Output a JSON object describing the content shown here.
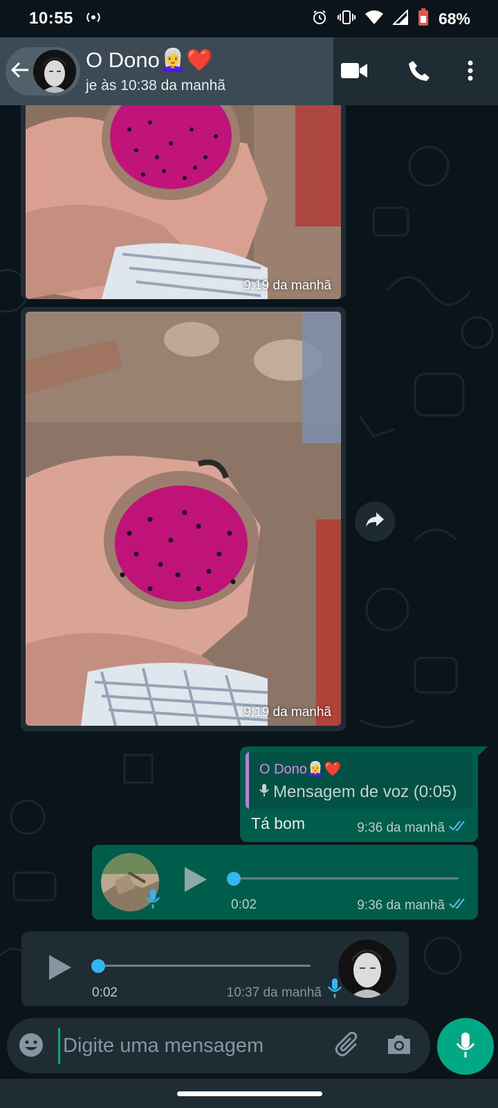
{
  "status_bar": {
    "time": "10:55",
    "battery": "68%",
    "icons": [
      "radio-icon",
      "alarm-icon",
      "vibrate-icon",
      "wifi-icon",
      "signal-icon",
      "battery-icon"
    ]
  },
  "header": {
    "contact_name": "O Dono👩‍🦳❤️",
    "last_seen": "je às 10:38 da manhã",
    "icons": [
      "back-arrow-icon",
      "video-call-icon",
      "voice-call-icon",
      "more-menu-icon"
    ]
  },
  "messages": [
    {
      "type": "image",
      "direction": "incoming",
      "time": "9:19 da manhã",
      "description": "fruit-photo"
    },
    {
      "type": "image",
      "direction": "incoming",
      "time": "9:19 da manhã",
      "description": "fruit-photo"
    },
    {
      "type": "text",
      "direction": "outgoing",
      "quote": {
        "author": "O Dono👩‍🦳❤️",
        "text": "Mensagem de voz (0:05)"
      },
      "text": "Tá bom",
      "time": "9:36 da manhã",
      "read": true
    },
    {
      "type": "voice",
      "direction": "outgoing",
      "duration": "0:02",
      "time": "9:36 da manhã",
      "read": true,
      "progress": 0
    },
    {
      "type": "voice",
      "direction": "incoming",
      "duration": "0:02",
      "time": "10:37 da manhã",
      "progress": 0
    }
  ],
  "composer": {
    "placeholder": "Digite uma mensagem",
    "icons": [
      "emoji-icon",
      "attach-icon",
      "camera-icon",
      "mic-icon"
    ]
  },
  "colors": {
    "background": "#0b141a",
    "header": "#1f2c34",
    "outgoing_bubble": "#005c4b",
    "incoming_bubble": "#1f2c34",
    "accent": "#00a884",
    "read_ticks": "#53bdeb"
  }
}
